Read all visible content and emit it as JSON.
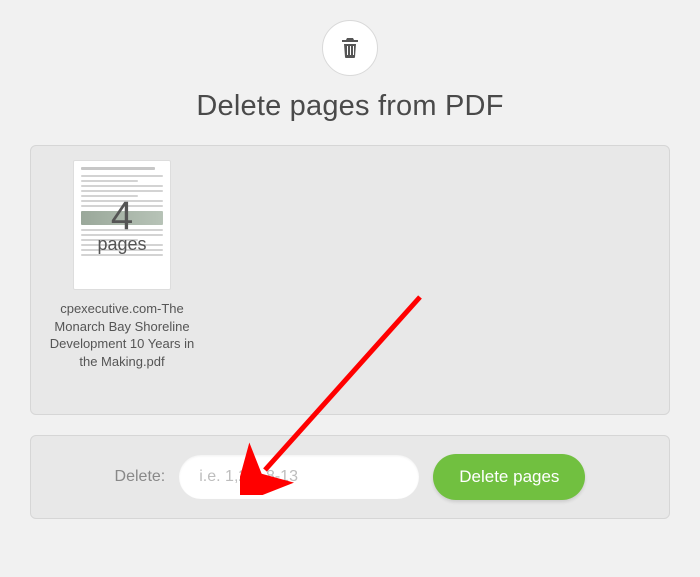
{
  "header": {
    "title": "Delete pages from PDF"
  },
  "icon": {
    "name": "trash-icon"
  },
  "file": {
    "page_count": "4",
    "pages_label": "pages",
    "filename": "cpexecutive.com-The Monarch Bay Shoreline Development 10 Years in the Making.pdf"
  },
  "form": {
    "label": "Delete:",
    "input_placeholder": "i.e. 1,2-4,8-13",
    "button_label": "Delete pages"
  },
  "colors": {
    "accent_green": "#71c040",
    "arrow_red": "#ff0000"
  }
}
